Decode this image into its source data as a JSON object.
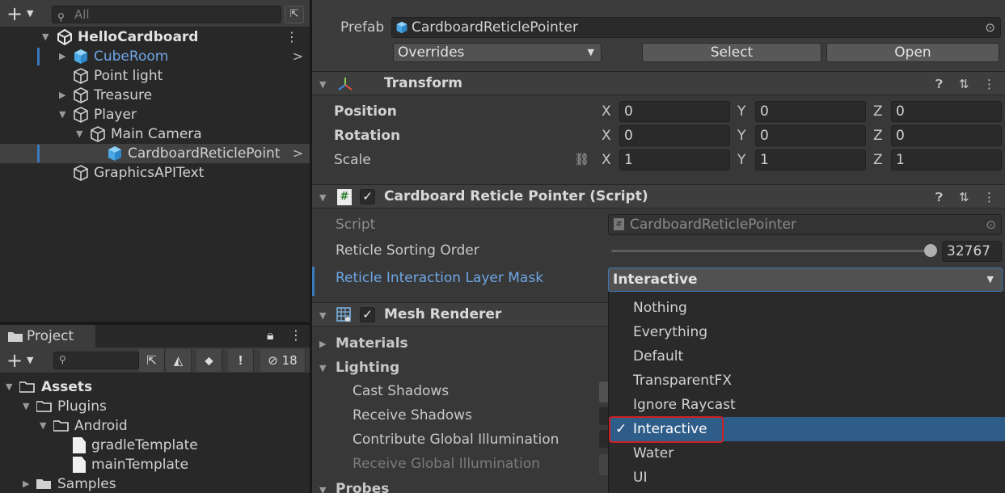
{
  "hierarchy": {
    "search_placeholder": "All",
    "items": [
      {
        "label": "HelloCardboard"
      },
      {
        "label": "CubeRoom"
      },
      {
        "label": "Point light"
      },
      {
        "label": "Treasure"
      },
      {
        "label": "Player"
      },
      {
        "label": "Main Camera"
      },
      {
        "label": "CardboardReticlePoint"
      },
      {
        "label": "GraphicsAPIText"
      }
    ]
  },
  "project": {
    "tab_label": "Project",
    "hidden_count": "18",
    "items": [
      {
        "label": "Assets"
      },
      {
        "label": "Plugins"
      },
      {
        "label": "Android"
      },
      {
        "label": "gradleTemplate"
      },
      {
        "label": "mainTemplate"
      },
      {
        "label": "Samples"
      }
    ]
  },
  "inspector": {
    "prefab_label": "Prefab",
    "prefab_value": "CardboardReticlePointer",
    "overrides_label": "Overrides",
    "select_label": "Select",
    "open_label": "Open",
    "transform": {
      "title": "Transform",
      "position_label": "Position",
      "rotation_label": "Rotation",
      "scale_label": "Scale",
      "x": "X",
      "y": "Y",
      "z": "Z",
      "position": [
        "0",
        "0",
        "0"
      ],
      "rotation": [
        "0",
        "0",
        "0"
      ],
      "scale": [
        "1",
        "1",
        "1"
      ]
    },
    "script_component": {
      "title": "Cardboard Reticle Pointer (Script)",
      "script_label": "Script",
      "script_value": "CardboardReticlePointer",
      "sorting_label": "Reticle Sorting Order",
      "sorting_value": "32767",
      "sorting_fraction": 1.0,
      "mask_label": "Reticle Interaction Layer Mask",
      "mask_value": "Interactive"
    },
    "mesh_renderer": {
      "title": "Mesh Renderer",
      "materials_label": "Materials",
      "lighting_label": "Lighting",
      "cast_shadows_label": "Cast Shadows",
      "receive_shadows_label": "Receive Shadows",
      "contribute_gi_label": "Contribute Global Illumination",
      "receive_gi_label": "Receive Global Illumination",
      "probes_label": "Probes"
    }
  },
  "layer_menu": {
    "options": [
      "Nothing",
      "Everything",
      "Default",
      "TransparentFX",
      "Ignore Raycast",
      "Interactive",
      "Water",
      "UI"
    ],
    "selected": "Interactive",
    "check": "✓"
  },
  "colors": {
    "selection": "#2f5d8a",
    "highlight_box": "#d02020",
    "active_label": "#6ea6e6",
    "cube_blue": "#5ab4ee"
  }
}
